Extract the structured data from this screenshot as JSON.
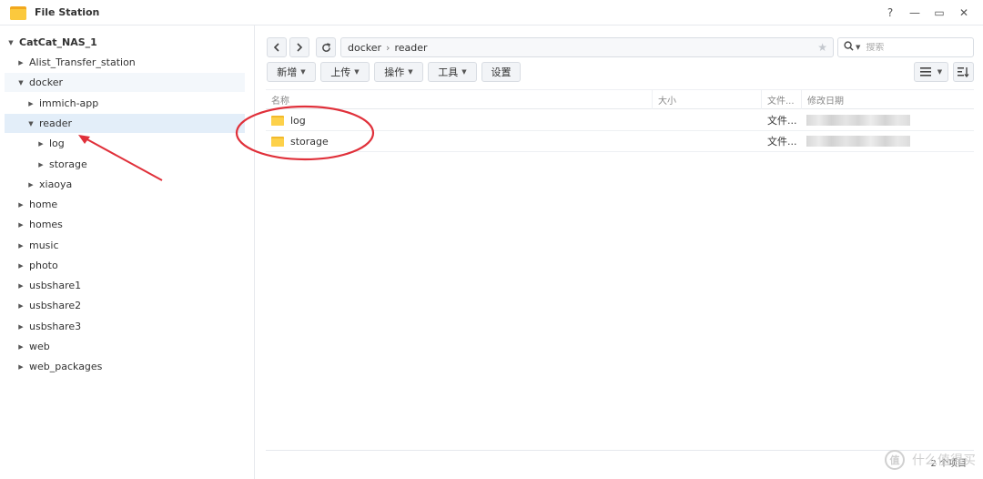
{
  "app": {
    "title": "File Station",
    "window_controls": [
      "?",
      "—",
      "▭",
      "✕"
    ]
  },
  "tree": [
    {
      "label": "CatCat_NAS_1",
      "depth": 0,
      "expanded": true,
      "root": true
    },
    {
      "label": "Alist_Transfer_station",
      "depth": 1,
      "expanded": false
    },
    {
      "label": "docker",
      "depth": 1,
      "expanded": true
    },
    {
      "label": "immich-app",
      "depth": 2,
      "expanded": false
    },
    {
      "label": "reader",
      "depth": 2,
      "expanded": true,
      "selected": true
    },
    {
      "label": "log",
      "depth": 3,
      "expanded": false
    },
    {
      "label": "storage",
      "depth": 3,
      "expanded": false
    },
    {
      "label": "xiaoya",
      "depth": 2,
      "expanded": false
    },
    {
      "label": "home",
      "depth": 1,
      "expanded": false
    },
    {
      "label": "homes",
      "depth": 1,
      "expanded": false
    },
    {
      "label": "music",
      "depth": 1,
      "expanded": false
    },
    {
      "label": "photo",
      "depth": 1,
      "expanded": false
    },
    {
      "label": "usbshare1",
      "depth": 1,
      "expanded": false
    },
    {
      "label": "usbshare2",
      "depth": 1,
      "expanded": false
    },
    {
      "label": "usbshare3",
      "depth": 1,
      "expanded": false
    },
    {
      "label": "web",
      "depth": 1,
      "expanded": false
    },
    {
      "label": "web_packages",
      "depth": 1,
      "expanded": false
    }
  ],
  "nav": {
    "back_icon": "chevron-left-icon",
    "forward_icon": "chevron-right-icon",
    "refresh_icon": "refresh-icon"
  },
  "path": {
    "segments": [
      "docker",
      "reader"
    ],
    "separator": "›"
  },
  "search": {
    "placeholder": "搜索"
  },
  "toolbar": {
    "create": "新增",
    "upload": "上传",
    "action": "操作",
    "tools": "工具",
    "settings": "设置"
  },
  "columns": {
    "name": "名称",
    "size": "大小",
    "type": "文件...",
    "modified": "修改日期"
  },
  "files": [
    {
      "name": "log",
      "size": "",
      "type": "文件..."
    },
    {
      "name": "storage",
      "size": "",
      "type": "文件..."
    }
  ],
  "footer": {
    "count": "2 个项目"
  },
  "watermark": {
    "seal": "值",
    "text": "什么值得买"
  },
  "colors": {
    "selected_row": "#e3eef9",
    "parent_row": "#f3f7fb",
    "annotation": "#e0303a",
    "folder": "#fdd14a"
  }
}
